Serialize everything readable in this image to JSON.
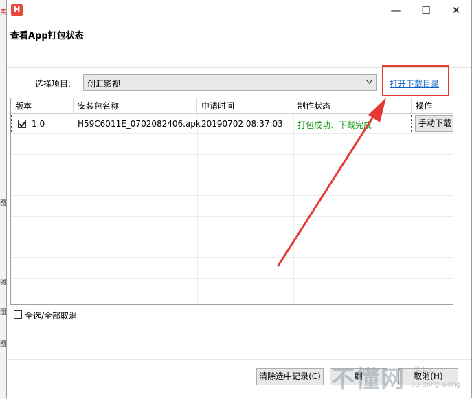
{
  "background_window": {
    "left_edge_glyphs": [
      "实",
      "图",
      "图",
      "图",
      "图"
    ]
  },
  "titlebar": {
    "app_icon_letter": "H",
    "minimize": "—",
    "maximize": "☐",
    "close": "✕"
  },
  "dialog": {
    "title": "查看App打包状态"
  },
  "project_select": {
    "label": "选择项目:",
    "value": "创汇影视",
    "open_dir_link": "打开下载目录"
  },
  "table": {
    "columns": [
      "版本",
      "安装包名称",
      "申请时间",
      "制作状态",
      "操作"
    ],
    "rows": [
      {
        "checked": true,
        "version": "1.0",
        "package": "H59C6011E_0702082406.apk",
        "time": "20190702 08:37:03",
        "status": "打包成功、下载完成",
        "action": "手动下载"
      }
    ]
  },
  "select_all": {
    "label": "全选/全部取消",
    "checked": false
  },
  "footer": {
    "clear_button": "清除选中记录(C)",
    "refresh_button": "刷",
    "cancel_button": "取消(H)"
  },
  "watermark": {
    "brand": "不懂网",
    "sub": "爱上无",
    "url": "bu-dong-wang"
  },
  "colors": {
    "annotation_red": "#e53935",
    "link_blue": "#0b63c5",
    "status_green": "#1a9a1a"
  }
}
